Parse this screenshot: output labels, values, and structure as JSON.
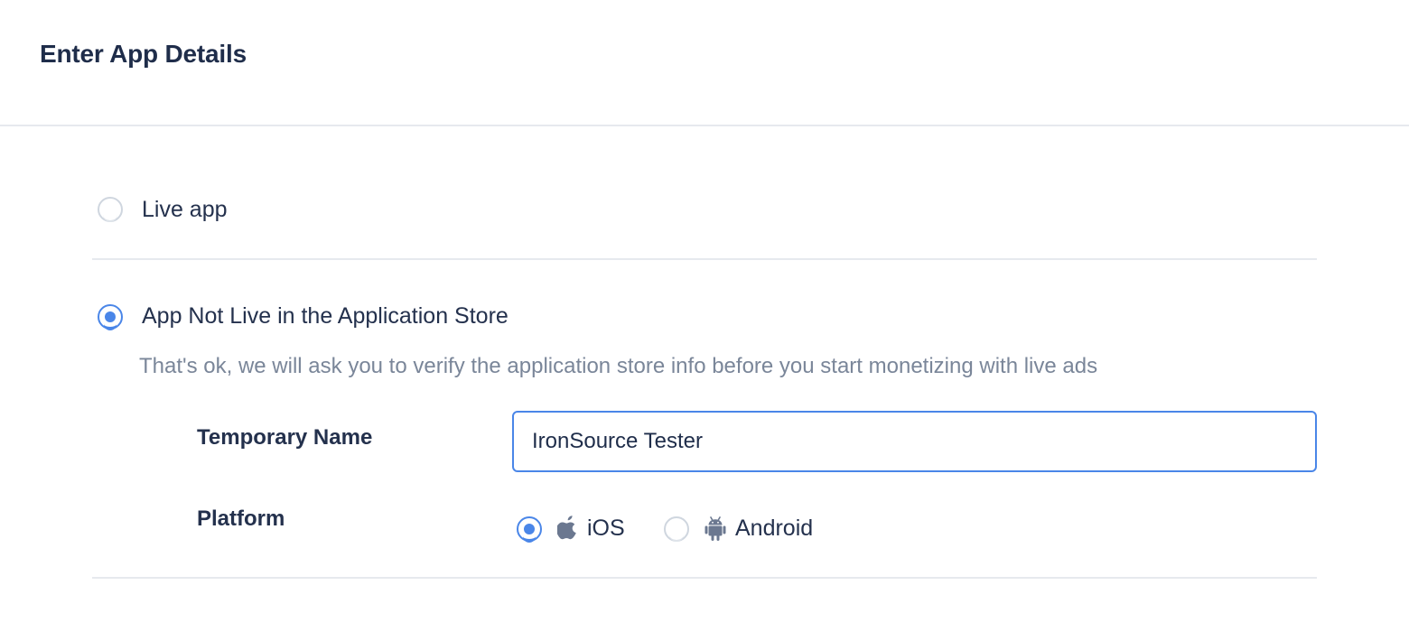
{
  "header": {
    "title": "Enter App Details"
  },
  "options": {
    "live_app": {
      "label": "Live app",
      "selected": false
    },
    "not_live": {
      "label": "App Not Live in the Application Store",
      "selected": true,
      "hint": "That's ok, we will ask you to verify the application store info before you start monetizing with live ads"
    }
  },
  "form": {
    "temporary_name_label": "Temporary Name",
    "temporary_name_value": "IronSource Tester",
    "platform_label": "Platform",
    "platforms": [
      {
        "label": "iOS",
        "icon": "apple-icon",
        "selected": true
      },
      {
        "label": "Android",
        "icon": "android-icon",
        "selected": false
      }
    ]
  },
  "colors": {
    "accent": "#4a86e8",
    "text_primary": "#24314d",
    "text_muted": "#7a8699",
    "divider": "#e6e9ee"
  }
}
